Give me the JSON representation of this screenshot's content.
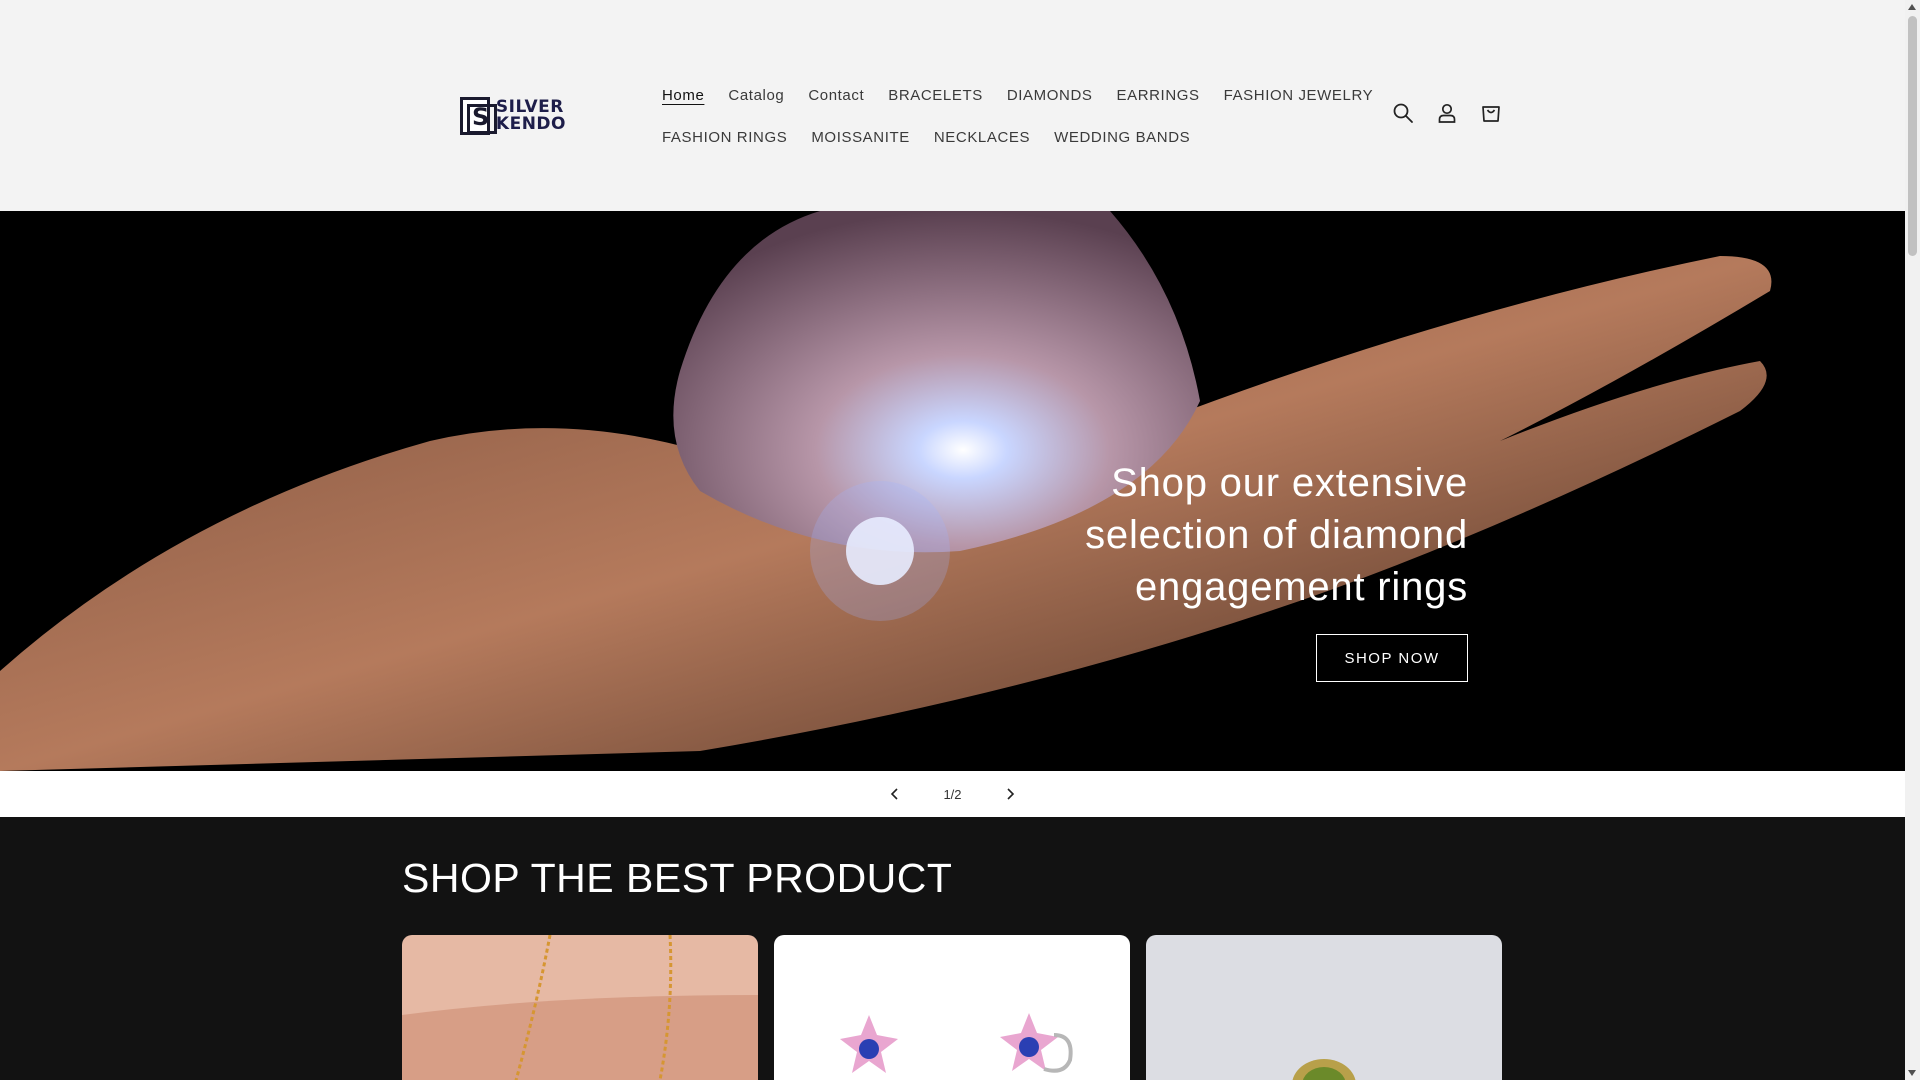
{
  "brand": {
    "logo_line1": "SILVER",
    "logo_line2": "KENDO"
  },
  "nav": {
    "row1": [
      "Home",
      "Catalog",
      "Contact",
      "BRACELETS",
      "DIAMONDS",
      "EARRINGS",
      "FASHION JEWELRY"
    ],
    "row2": [
      "FASHION RINGS",
      "MOISSANITE",
      "NECKLACES",
      "WEDDING BANDS"
    ],
    "active": "Home"
  },
  "header_icons": [
    "search-icon",
    "account-icon",
    "cart-icon"
  ],
  "hero": {
    "line1": "Shop our extensive",
    "line2": "selection of diamond",
    "line3": "engagement rings",
    "button_label": "SHOP NOW"
  },
  "slider": {
    "counter": "1/2",
    "prev_icon": "chevron-left-icon",
    "next_icon": "chevron-right-icon"
  },
  "products": {
    "heading": "SHOP THE BEST PRODUCT"
  },
  "colors": {
    "header_bg": "#f3f3f3",
    "section_dark": "#121212",
    "text_dark": "#121212"
  }
}
